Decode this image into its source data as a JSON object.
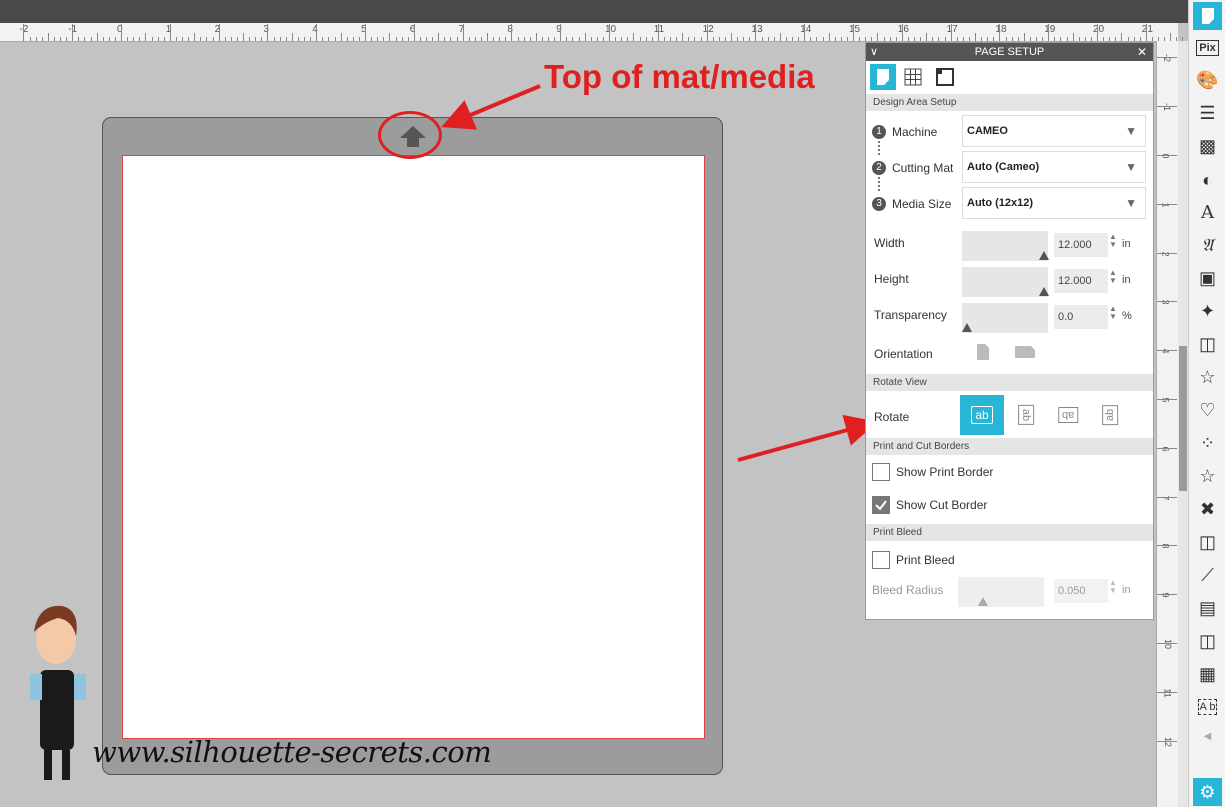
{
  "ruler": {
    "horizontal_labels": [
      "-2",
      "-1",
      "0",
      "1",
      "2",
      "3",
      "4",
      "5",
      "6",
      "7",
      "8",
      "9",
      "10",
      "11",
      "12",
      "13",
      "14",
      "15",
      "16",
      "17",
      "18",
      "19",
      "20",
      "21"
    ],
    "vertical_labels": [
      "-2",
      "-1",
      "0",
      "1",
      "2",
      "3",
      "4",
      "5",
      "6",
      "7",
      "8",
      "9",
      "10",
      "11",
      "12"
    ]
  },
  "annotation": {
    "top_label": "Top of mat/media",
    "watermark": "www.silhouette-secrets.com",
    "arrow_color": "#e02020"
  },
  "panel": {
    "title": "PAGE SETUP",
    "tabs": [
      {
        "icon": "page-icon",
        "active": true
      },
      {
        "icon": "grid-icon",
        "active": false
      },
      {
        "icon": "registration-marks-icon",
        "active": false
      }
    ],
    "design_area_section": "Design Area Setup",
    "machine_step": "1",
    "machine_label": "Machine",
    "machine_value": "CAMEO",
    "cutting_mat_step": "2",
    "cutting_mat_label": "Cutting Mat",
    "cutting_mat_value": "Auto (Cameo)",
    "media_size_step": "3",
    "media_size_label": "Media Size",
    "media_size_value": "Auto (12x12)",
    "width_label": "Width",
    "width_value": "12.000",
    "width_unit": "in",
    "height_label": "Height",
    "height_value": "12.000",
    "height_unit": "in",
    "transparency_label": "Transparency",
    "transparency_value": "0.0",
    "transparency_unit": "%",
    "orientation_label": "Orientation",
    "rotate_view_section": "Rotate View",
    "rotate_label": "Rotate",
    "rotate_options": [
      "ab",
      "ab",
      "ab",
      "ab"
    ],
    "print_cut_section": "Print and Cut Borders",
    "show_print_border_label": "Show Print Border",
    "show_print_border_checked": false,
    "show_cut_border_label": "Show Cut Border",
    "show_cut_border_checked": true,
    "print_bleed_section": "Print Bleed",
    "print_bleed_label": "Print Bleed",
    "print_bleed_checked": false,
    "bleed_radius_label": "Bleed Radius",
    "bleed_radius_value": "0.050",
    "bleed_radius_unit": "in"
  },
  "toolbar": {
    "items": [
      "page-setup-icon",
      "pix-icon",
      "fill-color-icon",
      "line-style-icon",
      "image-effects-icon",
      "transparency-icon",
      "text-style-icon",
      "font-icon",
      "align-icon",
      "replicate-icon",
      "modify-icon",
      "offset-icon",
      "trace-icon",
      "stars-icon",
      "design-store-icon",
      "sketch-icon",
      "puzzle-icon",
      "library-icon",
      "hatch-icon",
      "nest-icon",
      "3d-icon",
      "warp-icon",
      "send-icon"
    ],
    "pix_label": "Pix",
    "text_label": "A",
    "ab_label": "A b"
  },
  "colors": {
    "accent": "#29b6d6",
    "canvas": "#c3c3c3",
    "mat": "#9c9c9c"
  }
}
